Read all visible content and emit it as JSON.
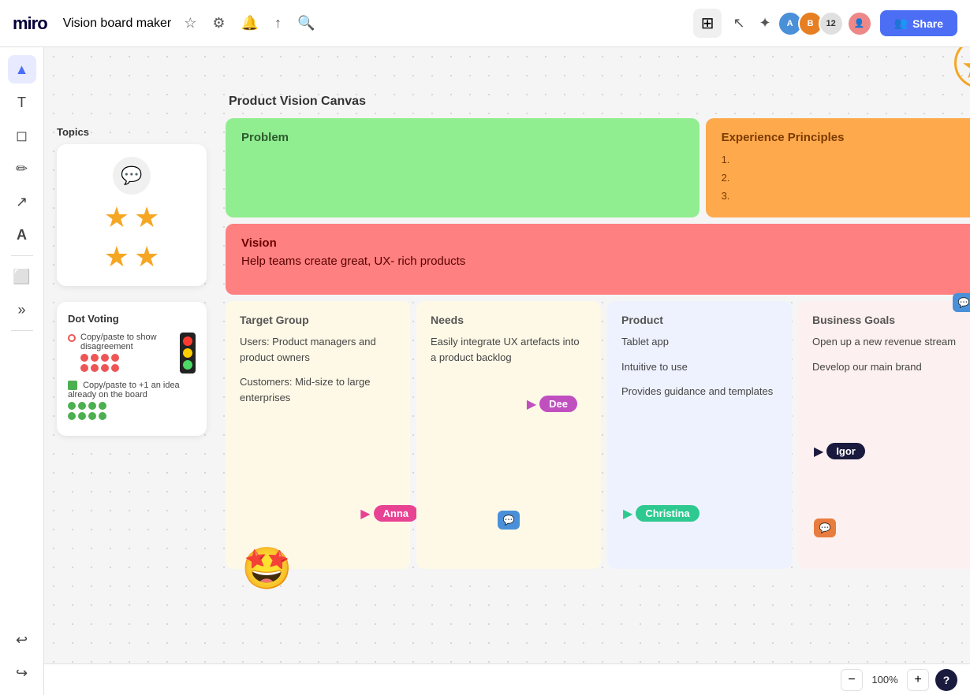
{
  "app": {
    "logo": "miro",
    "board_title": "Vision board maker",
    "star_icon": "☆",
    "settings_icon": "⚙",
    "bell_icon": "🔔",
    "share_icon": "↑",
    "search_icon": "🔍",
    "share_label": "Share",
    "collaborator_count": "12",
    "zoom_level": "100%"
  },
  "toolbar": {
    "tools": [
      {
        "name": "cursor",
        "icon": "▲",
        "active": true
      },
      {
        "name": "text",
        "icon": "T",
        "active": false
      },
      {
        "name": "sticky",
        "icon": "◻",
        "active": false
      },
      {
        "name": "pen",
        "icon": "✏",
        "active": false
      },
      {
        "name": "arrow",
        "icon": "↗",
        "active": false
      },
      {
        "name": "shapes",
        "icon": "A",
        "active": false
      },
      {
        "name": "frame",
        "icon": "⬜",
        "active": false
      },
      {
        "name": "more",
        "icon": "»",
        "active": false
      }
    ]
  },
  "sidebar": {
    "topics_title": "Topics",
    "dot_voting_title": "Dot Voting",
    "dv_item1_text": "Copy/paste to show disagreement",
    "dv_item2_text": "Copy/paste to +1 an idea already on the board"
  },
  "canvas": {
    "title": "Product Vision Canvas",
    "problem_label": "Problem",
    "experience_label": "Experience Principles",
    "experience_items": [
      "",
      "",
      ""
    ],
    "vision_label": "Vision",
    "vision_text": "Help teams create great, UX- rich products",
    "target_group": {
      "title": "Target Group",
      "text1": "Users: Product managers and product owners",
      "text2": "Customers: Mid-size to large enterprises"
    },
    "needs": {
      "title": "Needs",
      "text1": "Easily integrate UX artefacts into a product backlog"
    },
    "product": {
      "title": "Product",
      "text1": "Tablet app",
      "text2": "Intuitive to use",
      "text3": "Provides guidance and templates"
    },
    "business_goals": {
      "title": "Business Goals",
      "text1": "Open up a new revenue stream",
      "text2": "Develop our main brand"
    }
  },
  "cursors": {
    "dee": {
      "label": "Dee",
      "color": "#c050c0"
    },
    "anna": {
      "label": "Anna",
      "color": "#e84393"
    },
    "christina": {
      "label": "Christina",
      "color": "#2ec990"
    },
    "igor": {
      "label": "Igor",
      "color": "#1a1a3e"
    }
  }
}
